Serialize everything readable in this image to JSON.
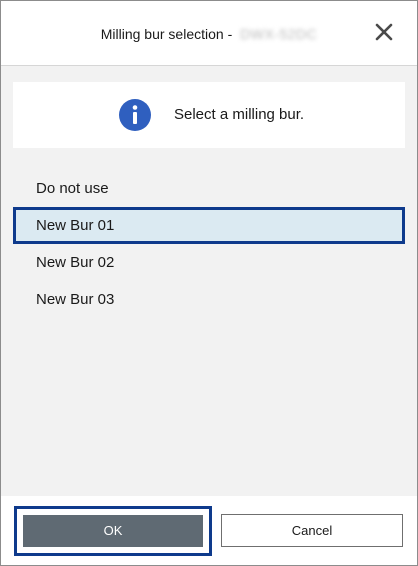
{
  "dialog": {
    "title": "Milling bur selection -",
    "title_suffix": "DWX-52DC",
    "close_icon": "close-icon"
  },
  "info": {
    "icon": "info-icon",
    "message": "Select a milling bur."
  },
  "burs": [
    {
      "label": "Do not use",
      "selected": false
    },
    {
      "label": "New Bur 01",
      "selected": true
    },
    {
      "label": "New Bur 02",
      "selected": false
    },
    {
      "label": "New Bur 03",
      "selected": false
    }
  ],
  "buttons": {
    "ok": "OK",
    "cancel": "Cancel"
  },
  "colors": {
    "accent": "#0e3a8c",
    "info_icon": "#2f5fbf",
    "selected_bg": "#dbeaf2",
    "ok_bg": "#5f6a73"
  }
}
